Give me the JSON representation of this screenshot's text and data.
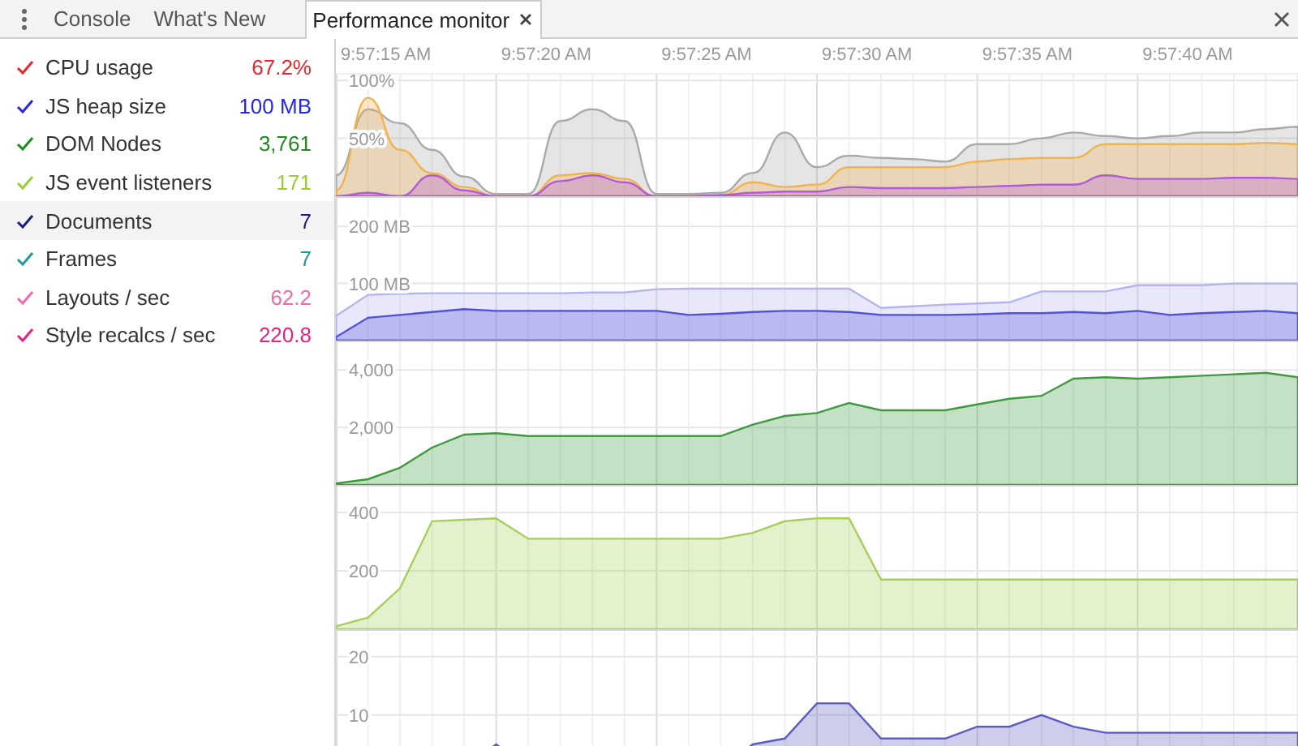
{
  "tabs": [
    {
      "label": "Console",
      "selected": false,
      "closable": false
    },
    {
      "label": "What's New",
      "selected": false,
      "closable": false
    },
    {
      "label": "Performance monitor",
      "selected": true,
      "closable": true
    }
  ],
  "metrics": [
    {
      "label": "CPU usage",
      "value": "67.2%",
      "color": "#e8262d",
      "checked": true,
      "highlighted": false
    },
    {
      "label": "JS heap size",
      "value": "100 MB",
      "color": "#2626e6",
      "checked": true,
      "highlighted": false
    },
    {
      "label": "DOM Nodes",
      "value": "3,761",
      "color": "#1f8a1f",
      "checked": true,
      "highlighted": false
    },
    {
      "label": "JS event listeners",
      "value": "171",
      "color": "#9acd32",
      "checked": true,
      "highlighted": false
    },
    {
      "label": "Documents",
      "value": "7",
      "color": "#1c1c80",
      "checked": true,
      "highlighted": true
    },
    {
      "label": "Frames",
      "value": "7",
      "color": "#1f9a9a",
      "checked": true,
      "highlighted": false
    },
    {
      "label": "Layouts / sec",
      "value": "62.2",
      "color": "#f06aa8",
      "checked": true,
      "highlighted": false
    },
    {
      "label": "Style recalcs / sec",
      "value": "220.8",
      "color": "#f01e82",
      "checked": true,
      "highlighted": false
    }
  ],
  "time_labels": [
    "9:57:15 AM",
    "9:57:20 AM",
    "9:57:25 AM",
    "9:57:30 AM",
    "9:57:35 AM",
    "9:57:40 AM"
  ],
  "charts": [
    {
      "kind": "curve",
      "chart_data": {
        "type": "area",
        "stacked": false,
        "grid": true,
        "categories": [
          null,
          null,
          null,
          null,
          null,
          null,
          null,
          null,
          null,
          null,
          null,
          null,
          null,
          null,
          null,
          null,
          null,
          null,
          null,
          null,
          null,
          null,
          null,
          null,
          null,
          null,
          null,
          null,
          null,
          null,
          null
        ],
        "ylim": [
          0,
          105
        ],
        "yticks": [
          {
            "value": 50,
            "label": "50%"
          },
          {
            "value": 100,
            "label": "100%"
          }
        ],
        "series": [
          {
            "color": "#aaaaaa",
            "values": [
              18,
              75,
              63,
              40,
              17,
              2,
              2,
              65,
              75,
              65,
              2,
              2,
              3,
              20,
              55,
              25,
              35,
              33,
              32,
              30,
              45,
              45,
              50,
              55,
              52,
              50,
              52,
              55,
              55,
              58,
              60
            ]
          },
          {
            "color": "#f2b24e",
            "values": [
              5,
              85,
              40,
              20,
              8,
              0,
              0,
              18,
              20,
              15,
              0,
              0,
              1,
              12,
              8,
              10,
              25,
              25,
              25,
              25,
              30,
              32,
              33,
              33,
              45,
              45,
              45,
              45,
              45,
              46,
              45
            ]
          },
          {
            "color": "#b35ad8",
            "values": [
              0,
              3,
              0,
              18,
              5,
              0,
              0,
              13,
              18,
              12,
              0,
              0,
              1,
              3,
              4,
              4,
              8,
              7,
              7,
              7,
              8,
              9,
              10,
              10,
              18,
              15,
              15,
              15,
              16,
              16,
              15
            ]
          }
        ]
      }
    },
    {
      "kind": "linear",
      "chart_data": {
        "type": "area",
        "stacked": false,
        "grid": true,
        "categories": [
          null,
          null,
          null,
          null,
          null,
          null,
          null,
          null,
          null,
          null,
          null,
          null,
          null,
          null,
          null,
          null,
          null,
          null,
          null,
          null,
          null,
          null,
          null,
          null,
          null,
          null,
          null,
          null,
          null,
          null,
          null
        ],
        "ylim": [
          0,
          250
        ],
        "yticks": [
          {
            "value": 100,
            "label": "100 MB"
          },
          {
            "value": 200,
            "label": "200 MB"
          }
        ],
        "series": [
          {
            "color": "#b4b4f0",
            "values": [
              43,
              80,
              82,
              83,
              83,
              83,
              83,
              83,
              84,
              84,
              90,
              91,
              91,
              91,
              91,
              91,
              91,
              57,
              60,
              63,
              65,
              67,
              86,
              86,
              86,
              97,
              97,
              97,
              100,
              100,
              100
            ]
          },
          {
            "color": "#5050dc",
            "values": [
              6,
              40,
              45,
              50,
              55,
              52,
              52,
              52,
              52,
              52,
              52,
              45,
              47,
              50,
              52,
              52,
              50,
              45,
              45,
              45,
              46,
              48,
              48,
              50,
              48,
              52,
              45,
              48,
              50,
              52,
              48
            ]
          }
        ]
      }
    },
    {
      "kind": "linear",
      "chart_data": {
        "type": "area",
        "stacked": false,
        "grid": true,
        "categories": [
          null,
          null,
          null,
          null,
          null,
          null,
          null,
          null,
          null,
          null,
          null,
          null,
          null,
          null,
          null,
          null,
          null,
          null,
          null,
          null,
          null,
          null,
          null,
          null,
          null,
          null,
          null,
          null,
          null,
          null,
          null
        ],
        "ylim": [
          0,
          4970
        ],
        "yticks": [
          {
            "value": 2000,
            "label": "2,000"
          },
          {
            "value": 4000,
            "label": "4,000"
          }
        ],
        "series": [
          {
            "color": "#3f9a3f",
            "values": [
              50,
              200,
              600,
              1300,
              1750,
              1800,
              1700,
              1700,
              1700,
              1700,
              1700,
              1700,
              1700,
              2100,
              2400,
              2500,
              2850,
              2600,
              2600,
              2600,
              2800,
              3000,
              3100,
              3700,
              3750,
              3700,
              3750,
              3800,
              3850,
              3900,
              3750
            ]
          }
        ]
      }
    },
    {
      "kind": "linear",
      "chart_data": {
        "type": "area",
        "stacked": false,
        "grid": true,
        "categories": [
          null,
          null,
          null,
          null,
          null,
          null,
          null,
          null,
          null,
          null,
          null,
          null,
          null,
          null,
          null,
          null,
          null,
          null,
          null,
          null,
          null,
          null,
          null,
          null,
          null,
          null,
          null,
          null,
          null,
          null,
          null
        ],
        "ylim": [
          0,
          489
        ],
        "yticks": [
          {
            "value": 200,
            "label": "200"
          },
          {
            "value": 400,
            "label": "400"
          }
        ],
        "series": [
          {
            "color": "#a6cf5a",
            "values": [
              10,
              40,
              140,
              370,
              375,
              380,
              310,
              310,
              310,
              310,
              310,
              310,
              310,
              330,
              370,
              380,
              380,
              170,
              170,
              170,
              170,
              170,
              170,
              170,
              170,
              170,
              170,
              170,
              170,
              170,
              170
            ]
          }
        ]
      }
    },
    {
      "kind": "linear",
      "chart_data": {
        "type": "area",
        "stacked": false,
        "grid": true,
        "categories": [
          null,
          null,
          null,
          null,
          null,
          null,
          null,
          null,
          null,
          null,
          null,
          null,
          null,
          null,
          null,
          null,
          null,
          null,
          null,
          null,
          null,
          null,
          null,
          null,
          null,
          null,
          null,
          null,
          null,
          null,
          null
        ],
        "ylim": [
          0,
          24.4
        ],
        "yticks": [
          {
            "value": 10,
            "label": "10"
          },
          {
            "value": 20,
            "label": "20"
          }
        ],
        "series": [
          {
            "color": "#5c5cc0",
            "values": [
              1,
              1,
              1,
              1,
              1,
              5,
              1,
              1,
              1,
              1,
              1,
              1,
              1,
              5,
              6,
              12,
              12,
              6,
              6,
              6,
              8,
              8,
              10,
              8,
              7,
              7,
              7,
              7,
              7,
              7,
              7
            ]
          }
        ]
      }
    }
  ]
}
